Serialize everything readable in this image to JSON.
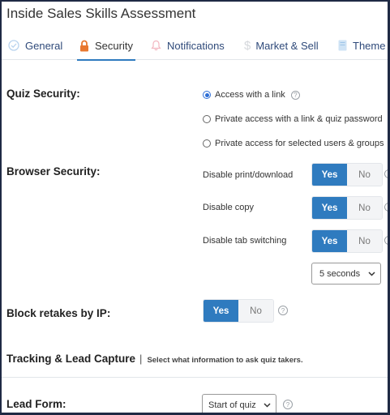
{
  "window": {
    "title": "Inside Sales Skills Assessment"
  },
  "tabs": [
    {
      "label": "General",
      "icon": "check-circle-icon"
    },
    {
      "label": "Security",
      "icon": "lock-icon",
      "active": true
    },
    {
      "label": "Notifications",
      "icon": "bell-icon"
    },
    {
      "label": "Market & Sell",
      "icon": "dollar-icon"
    },
    {
      "label": "Theme",
      "icon": "document-icon"
    }
  ],
  "quiz_security": {
    "label": "Quiz Security:",
    "options": [
      {
        "label": "Access with a link",
        "checked": true
      },
      {
        "label": "Private access with a link & quiz password",
        "checked": false
      },
      {
        "label": "Private access for selected users & groups",
        "checked": false
      }
    ]
  },
  "browser_security": {
    "label": "Browser Security:",
    "options": [
      {
        "label": "Disable print/download",
        "yes": "Yes",
        "no": "No",
        "value": "Yes"
      },
      {
        "label": "Disable copy",
        "yes": "Yes",
        "no": "No",
        "value": "Yes"
      },
      {
        "label": "Disable tab switching",
        "yes": "Yes",
        "no": "No",
        "value": "Yes"
      }
    ],
    "tab_switch_delay": "5 seconds"
  },
  "block_retakes": {
    "label": "Block retakes by IP:",
    "yes": "Yes",
    "no": "No",
    "value": "Yes"
  },
  "tracking": {
    "title": "Tracking & Lead Capture",
    "separator": "|",
    "subtitle": "Select what information to ask quiz takers."
  },
  "lead_form": {
    "label": "Lead Form:",
    "value": "Start of quiz"
  },
  "colors": {
    "accent": "#2f7bbf",
    "radio": "#2f6fd6",
    "tab_text": "#2f4a7a",
    "lock": "#e8772e"
  }
}
